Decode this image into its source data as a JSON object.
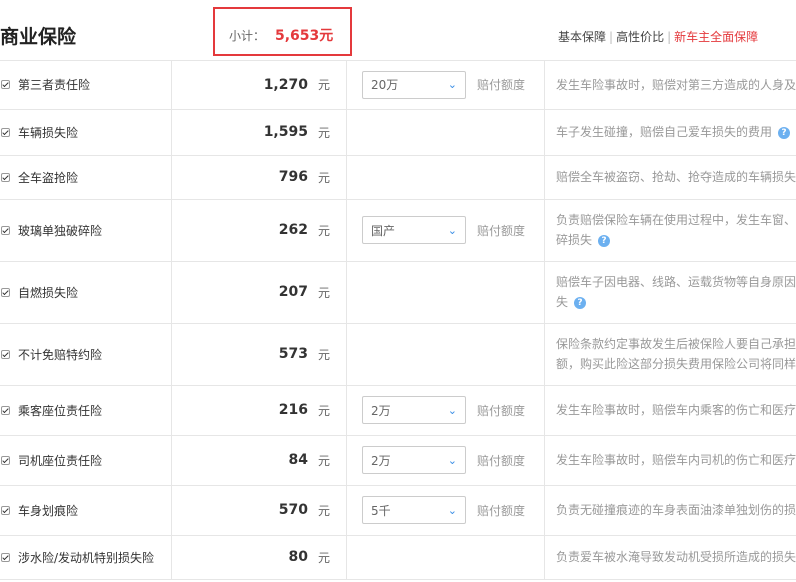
{
  "header": {
    "title": "商业保险",
    "subtotal_label": "小计：",
    "subtotal_value": "5,653元",
    "plans": [
      {
        "label": "基本保障",
        "active": false
      },
      {
        "label": "高性价比",
        "active": false
      },
      {
        "label": "新车主全面保障",
        "active": true
      }
    ]
  },
  "unit": "元",
  "option_label": "赔付额度",
  "rows": [
    {
      "name": "第三者责任险",
      "price": "1,270",
      "select": "20万",
      "desc": "发生车险事故时，赔偿对第三方造成的人身及"
    },
    {
      "name": "车辆损失险",
      "price": "1,595",
      "select": "",
      "desc": "车子发生碰撞，赔偿自己爱车损失的费用"
    },
    {
      "name": "全车盗抢险",
      "price": "796",
      "select": "",
      "desc": "赔偿全车被盗窃、抢劫、抢夺造成的车辆损失"
    },
    {
      "name": "玻璃单独破碎险",
      "price": "262",
      "select": "国产",
      "desc": "负责赔偿保险车辆在使用过程中，发生车窗、碎损失"
    },
    {
      "name": "自燃损失险",
      "price": "207",
      "select": "",
      "desc": "赔偿车子因电器、线路、运载货物等自身原因失"
    },
    {
      "name": "不计免赔特约险",
      "price": "573",
      "select": "",
      "desc": "保险条款约定事故发生后被保险人要自己承担额，购买此险这部分损失费用保险公司将同样"
    },
    {
      "name": "乘客座位责任险",
      "price": "216",
      "select": "2万",
      "desc": "发生车险事故时，赔偿车内乘客的伤亡和医疗"
    },
    {
      "name": "司机座位责任险",
      "price": "84",
      "select": "2万",
      "desc": "发生车险事故时，赔偿车内司机的伤亡和医疗"
    },
    {
      "name": "车身划痕险",
      "price": "570",
      "select": "5千",
      "desc": "负责无碰撞痕迹的车身表面油漆单独划伤的损"
    },
    {
      "name": "涉水险/发动机特别损失险",
      "price": "80",
      "select": "",
      "desc": "负责爱车被水淹导致发动机受损所造成的损失"
    }
  ]
}
